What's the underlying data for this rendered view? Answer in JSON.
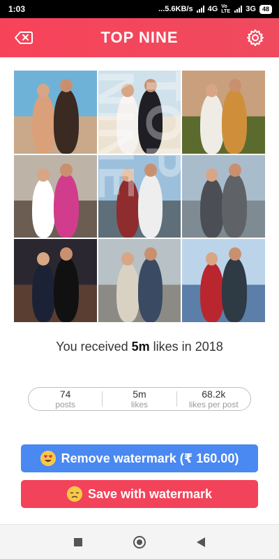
{
  "status_bar": {
    "time": "1:03",
    "network_speed": "...5.6KB/s",
    "signal_1": "4G",
    "signal_2": "3G",
    "volte": "Vo LTE",
    "battery": "48"
  },
  "header": {
    "title": "TOP NINE",
    "back_icon": "delete-left-icon",
    "settings_icon": "gear-icon",
    "color": "#f6435a"
  },
  "grid": {
    "watermark_text": "TOP NINE",
    "tiles": [
      {
        "sky": "#6fb2d8",
        "ground": "#c9a98a",
        "p1": "#d9a07a",
        "p2": "#3a2a22"
      },
      {
        "sky": "#cfe1ea",
        "ground": "#ece2d2",
        "p1": "#f4f1ee",
        "p2": "#1e1e24"
      },
      {
        "sky": "#c8a07e",
        "ground": "#5b6b2e",
        "p1": "#efece6",
        "p2": "#cf8f3a"
      },
      {
        "sky": "#bdb3a6",
        "ground": "#6b5d52",
        "p1": "#ffffff",
        "p2": "#d23c8c"
      },
      {
        "sky": "#9cc0dc",
        "ground": "#5f6f7a",
        "p1": "#8e2c2e",
        "p2": "#eeeeee"
      },
      {
        "sky": "#a9bccc",
        "ground": "#7f8b93",
        "p1": "#4b4f55",
        "p2": "#5f6266"
      },
      {
        "sky": "#2a2730",
        "ground": "#5a3e32",
        "p1": "#1c2235",
        "p2": "#111111"
      },
      {
        "sky": "#b7c1c6",
        "ground": "#8c8a84",
        "p1": "#d9d2c3",
        "p2": "#3b4a63"
      },
      {
        "sky": "#bcd4ea",
        "ground": "#5b7fa8",
        "p1": "#b9262e",
        "p2": "#2e3a44"
      }
    ]
  },
  "summary": {
    "prefix": "You received ",
    "likes": "5m",
    "suffix": " likes in 2018"
  },
  "stats": [
    {
      "value": "74",
      "label": "posts"
    },
    {
      "value": "5m",
      "label": "likes"
    },
    {
      "value": "68.2k",
      "label": "likes per post"
    }
  ],
  "buttons": {
    "remove_label": "Remove watermark (₹ 160.00)",
    "remove_icon": "heart-eyes-emoji-icon",
    "remove_color": "#4a88f2",
    "save_label": "Save with watermark",
    "save_icon": "disappointed-emoji-icon",
    "save_color": "#f2435a"
  },
  "nav": {
    "recents_icon": "square-icon",
    "home_icon": "circle-icon",
    "back_icon": "triangle-back-icon"
  }
}
